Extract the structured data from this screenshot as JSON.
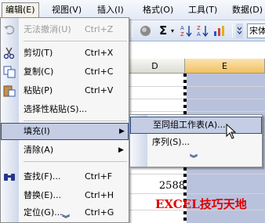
{
  "menubar": {
    "items": [
      {
        "label": "编辑(E)"
      },
      {
        "label": "视图(V)"
      },
      {
        "label": "插入(I)"
      },
      {
        "label": "格式(O)"
      },
      {
        "label": "工具(T)"
      },
      {
        "label": "数据(D)"
      }
    ]
  },
  "toolbar": {
    "sigma": "Σ",
    "font_value": "宋体"
  },
  "sheet": {
    "col_headers": [
      "D",
      "E"
    ],
    "cell_value": "2588",
    "watermark": "EXCEL技巧天地"
  },
  "edit_menu": {
    "items": [
      {
        "label": "无法撤消(U)",
        "shortcut": "Ctrl+Z",
        "icon": "undo-icon"
      },
      {
        "label": "剪切(T)",
        "shortcut": "Ctrl+X",
        "icon": "scissors-icon"
      },
      {
        "label": "复制(C)",
        "shortcut": "Ctrl+C",
        "icon": "copy-icon"
      },
      {
        "label": "粘贴(P)",
        "shortcut": "Ctrl+V",
        "icon": "paste-icon"
      },
      {
        "label": "选择性粘贴(S)..."
      },
      {
        "label": "填充(I)"
      },
      {
        "label": "清除(A)"
      },
      {
        "label": "查找(F)...",
        "shortcut": "Ctrl+F",
        "icon": "binoculars-icon"
      },
      {
        "label": "替换(E)...",
        "shortcut": "Ctrl+H"
      },
      {
        "label": "定位(G)...",
        "shortcut": "Ctrl+G"
      }
    ]
  },
  "fill_submenu": {
    "items": [
      {
        "label": "至同组工作表(A)..."
      },
      {
        "label": "序列(S)..."
      }
    ]
  },
  "colors": {
    "highlight": "#c4cde4",
    "highlight_border": "#30508a",
    "watermark": "#e00000",
    "selection": "#b9c2dd"
  }
}
